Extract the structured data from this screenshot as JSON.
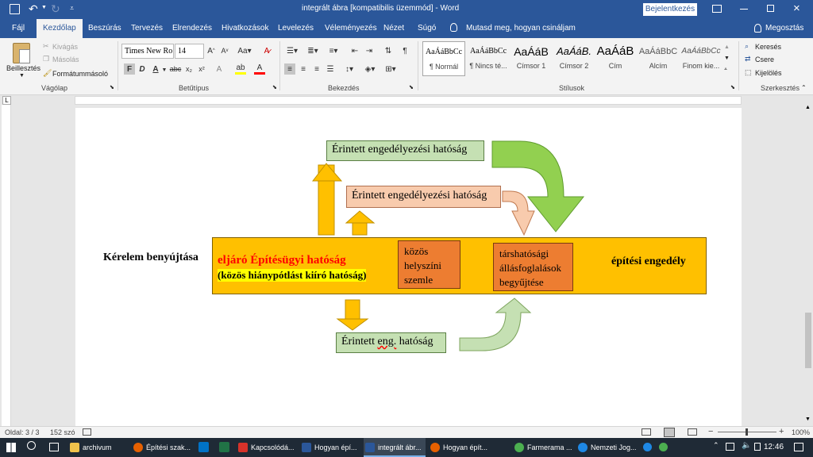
{
  "titlebar": {
    "title": "integrált ábra [kompatibilis üzemmód] - Word",
    "signin": "Bejelentkezés"
  },
  "tabs": [
    "Fájl",
    "Kezdőlap",
    "Beszúrás",
    "Tervezés",
    "Elrendezés",
    "Hivatkozások",
    "Levelezés",
    "Véleményezés",
    "Nézet",
    "Súgó"
  ],
  "active_tab": "Kezdőlap",
  "tellme": "Mutasd meg, hogyan csináljam",
  "share": "Megosztás",
  "ribbon": {
    "clipboard": {
      "paste": "Beillesztés",
      "cut": "Kivágás",
      "copy": "Másolás",
      "painter": "Formátummásoló",
      "label": "Vágólap"
    },
    "font": {
      "name": "Times New Ro",
      "size": "14",
      "label": "Betűtípus",
      "bold": "F",
      "italic": "D",
      "underline": "A"
    },
    "paragraph": {
      "label": "Bekezdés"
    },
    "styles": {
      "label": "Stílusok",
      "items": [
        {
          "preview": "AaÁáBbCc",
          "name": "¶ Normál"
        },
        {
          "preview": "AaÁáBbCc",
          "name": "¶ Nincs té..."
        },
        {
          "preview": "AaÁáB",
          "name": "Címsor 1"
        },
        {
          "preview": "AaÁáB.",
          "name": "Címsor 2"
        },
        {
          "preview": "AaÁáB",
          "name": "Cím"
        },
        {
          "preview": "AaÁáBbC",
          "name": "Alcím"
        },
        {
          "preview": "AaÁáBbCc",
          "name": "Finom kie..."
        }
      ]
    },
    "editing": {
      "find": "Keresés",
      "replace": "Csere",
      "select": "Kijelölés",
      "label": "Szerkesztés"
    }
  },
  "diagram": {
    "top_box": "Érintett engedélyezési hatóság",
    "mid_box": "Érintett engedélyezési hatóság",
    "request": "Kérelem benyújtása",
    "main_title": "eljáró Építésügyi hatóság",
    "main_sub": "(közös hiánypótlást kiíró hatóság)",
    "site": [
      "közös",
      "helyszíni",
      "szemle"
    ],
    "co_auth": [
      "társhatósági",
      "állásfoglalások",
      "begyűjtése"
    ],
    "permit": "építési engedély",
    "bottom_box_pre": "Érintett ",
    "bottom_box_eng": "eng.",
    "bottom_box_post": " hatóság"
  },
  "colors": {
    "word_blue": "#2b579a",
    "orange": "#ffc000",
    "dark_orange": "#ed7d31",
    "light_green": "#c5e0b3",
    "green": "#92d050",
    "peach": "#f8cbad",
    "red_text": "#ff0000"
  },
  "status": {
    "page": "Oldal: 3 / 3",
    "words": "152 szó",
    "zoom": "100%"
  },
  "taskbar": {
    "apps": [
      "archivum",
      "Építési szak...",
      "Kapcsolódá...",
      "Hogyan épí...",
      "integrált ábr...",
      "Hogyan épít...",
      "Farmerama ...",
      "Nemzeti Jog..."
    ],
    "clock": "12:46"
  }
}
